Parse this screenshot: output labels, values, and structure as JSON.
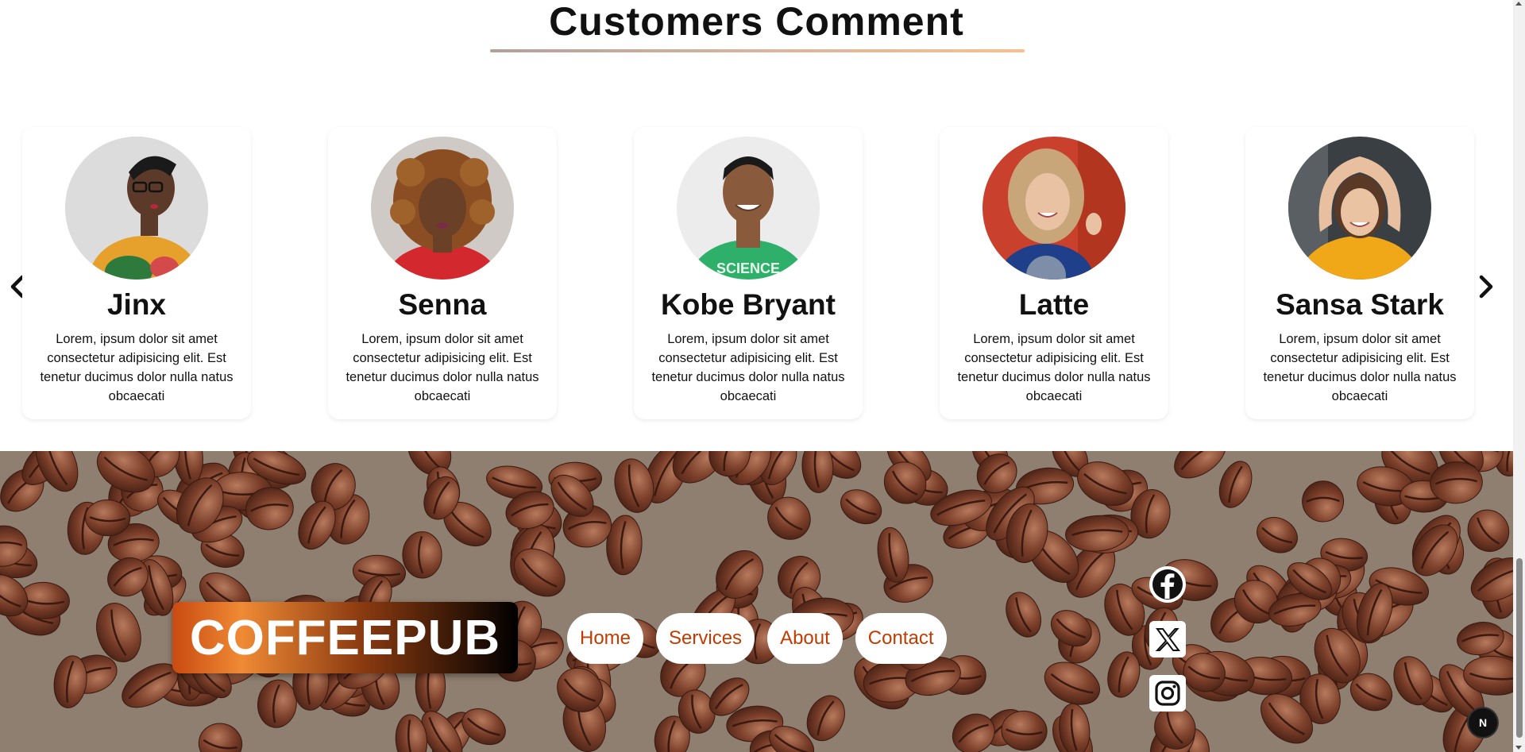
{
  "section": {
    "title": "Customers Comment"
  },
  "carousel": {
    "prev_icon": "chevron-left-icon",
    "next_icon": "chevron-right-icon",
    "cards": [
      {
        "name": "Jinx",
        "text": "Lorem, ipsum dolor sit amet consectetur adipisicing elit. Est tenetur ducimus dolor nulla natus obcaecati"
      },
      {
        "name": "Senna",
        "text": "Lorem, ipsum dolor sit amet consectetur adipisicing elit. Est tenetur ducimus dolor nulla natus obcaecati"
      },
      {
        "name": "Kobe Bryant",
        "text": "Lorem, ipsum dolor sit amet consectetur adipisicing elit. Est tenetur ducimus dolor nulla natus obcaecati"
      },
      {
        "name": "Latte",
        "text": "Lorem, ipsum dolor sit amet consectetur adipisicing elit. Est tenetur ducimus dolor nulla natus obcaecati"
      },
      {
        "name": "Sansa Stark",
        "text": "Lorem, ipsum dolor sit amet consectetur adipisicing elit. Est tenetur ducimus dolor nulla natus obcaecati"
      }
    ]
  },
  "footer": {
    "logo": "COFFEEPUB",
    "nav": [
      {
        "label": "Home"
      },
      {
        "label": "Services"
      },
      {
        "label": "About"
      },
      {
        "label": "Contact"
      }
    ],
    "social": [
      "facebook-icon",
      "x-icon",
      "instagram-icon"
    ]
  },
  "badge": {
    "label": "N"
  },
  "colors": {
    "nav_text": "#c23b00",
    "underline_start": "#b3a09b",
    "underline_end": "#f7c08e"
  }
}
